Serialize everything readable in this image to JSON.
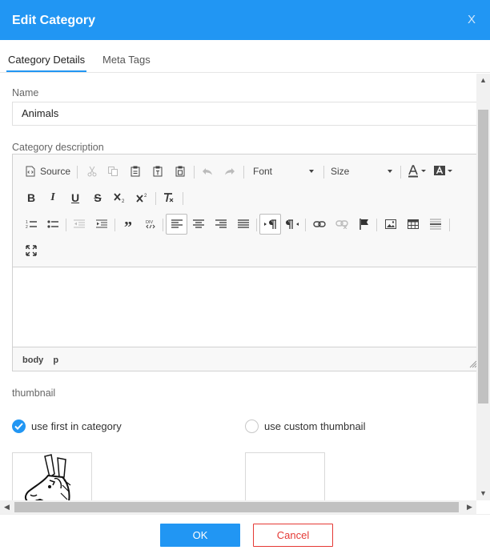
{
  "dialog": {
    "title": "Edit Category",
    "close_label": "X"
  },
  "tabs": [
    {
      "label": "Category Details",
      "active": true
    },
    {
      "label": "Meta Tags",
      "active": false
    }
  ],
  "form": {
    "name_label": "Name",
    "name_value": "Animals",
    "description_label": "Category description",
    "thumbnail_label": "thumbnail"
  },
  "editor": {
    "toolbar": {
      "source_label": "Source",
      "font_label": "Font",
      "size_label": "Size"
    },
    "path": [
      "body",
      "p"
    ]
  },
  "thumbnail": {
    "options": [
      {
        "label": "use first in category",
        "checked": true
      },
      {
        "label": "use custom thumbnail",
        "checked": false
      }
    ]
  },
  "footer": {
    "ok_label": "OK",
    "cancel_label": "Cancel"
  },
  "colors": {
    "accent": "#2196f3",
    "danger": "#e53935"
  }
}
